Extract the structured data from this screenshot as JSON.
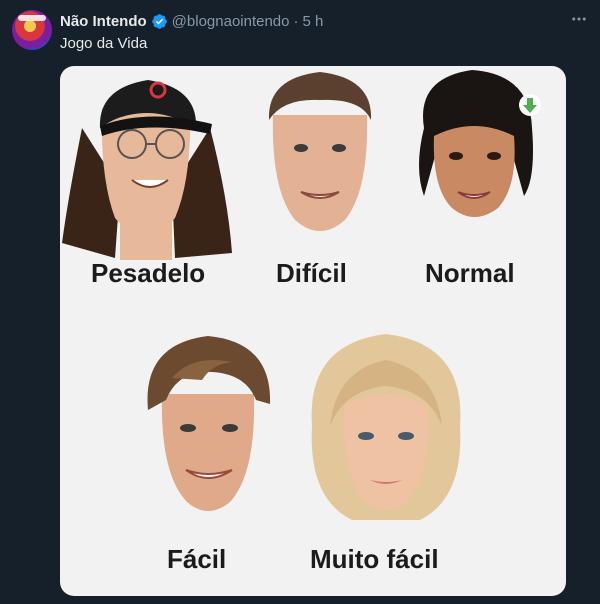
{
  "tweet": {
    "author_name": "Não Intendo",
    "handle": "@blognaointendo",
    "separator": "·",
    "time": "5 h",
    "more_icon": "more-icon",
    "verified_icon": "verified-badge-icon",
    "text": "Jogo da Vida"
  },
  "media": {
    "labels": [
      "Pesadelo",
      "Difícil",
      "Normal",
      "Fácil",
      "Muito fácil"
    ],
    "badge_icon": "download-arrow-icon",
    "colors": {
      "background": "#f2f2f2",
      "badge_arrow": "#4caf50",
      "label": "#1b1b1b"
    }
  }
}
